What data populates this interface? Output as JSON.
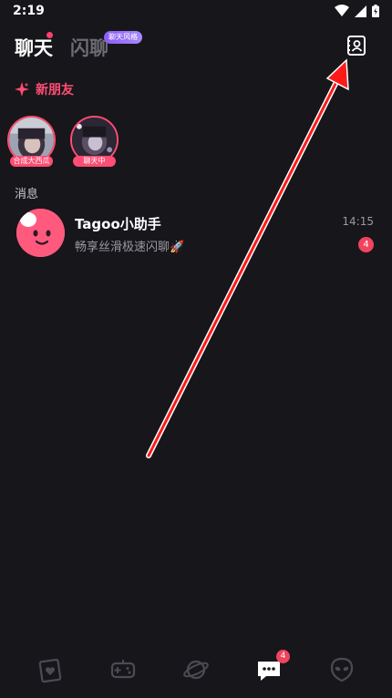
{
  "status_bar": {
    "time": "2:19"
  },
  "header": {
    "tab_chat": "聊天",
    "tab_flash": "闪聊",
    "flash_badge": "聊天风格"
  },
  "new_friends": {
    "label": "新朋友"
  },
  "friends": [
    {
      "tag": "合成大西瓜"
    },
    {
      "tag": "聊天中"
    }
  ],
  "messages_section": {
    "title": "消息"
  },
  "messages": [
    {
      "name": "Tagoo小助手",
      "preview": "畅享丝滑极速闪聊🚀",
      "time": "14:15",
      "unread": "4"
    }
  ],
  "bottom_nav": {
    "items": [
      "cards-icon",
      "game-icon",
      "planet-icon",
      "chat-icon",
      "alien-icon"
    ],
    "chat_badge": "4"
  },
  "colors": {
    "accent": "#ff4d73",
    "background": "#17161b",
    "badge": "#f0445e",
    "arrow": "#ff1a1a"
  }
}
